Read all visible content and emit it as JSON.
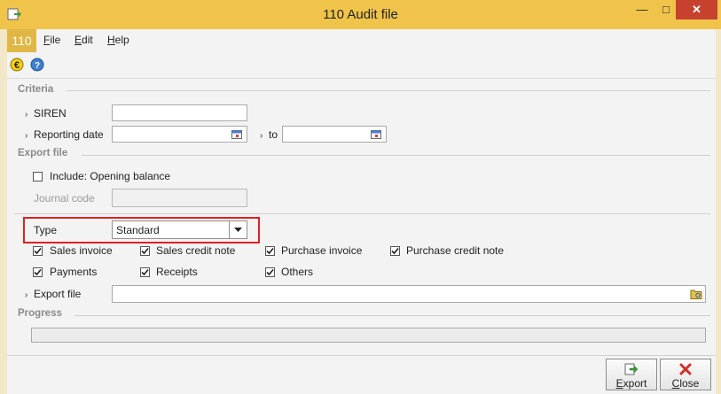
{
  "window": {
    "title": "110 Audit file"
  },
  "menubar": {
    "badge": "110",
    "items": [
      {
        "first": "F",
        "rest": "ile"
      },
      {
        "first": "E",
        "rest": "dit"
      },
      {
        "first": "H",
        "rest": "elp"
      }
    ]
  },
  "toolbar": {
    "icons": [
      "euro-icon",
      "help-icon"
    ]
  },
  "criteria": {
    "section_label": "Criteria",
    "siren_label": "SIREN",
    "siren_value": "",
    "reporting_date_label": "Reporting date",
    "reporting_date_from": "",
    "to_label": "to",
    "reporting_date_to": ""
  },
  "export": {
    "section_label": "Export file",
    "include_opening_balance_label": "Include: Opening balance",
    "include_opening_balance_checked": false,
    "journal_code_label": "Journal code",
    "journal_code_value": "",
    "type_label": "Type",
    "type_value": "Standard",
    "options": [
      {
        "label": "Sales invoice",
        "checked": true
      },
      {
        "label": "Sales credit note",
        "checked": true
      },
      {
        "label": "Purchase invoice",
        "checked": true
      },
      {
        "label": "Purchase credit note",
        "checked": true
      },
      {
        "label": "Payments",
        "checked": true
      },
      {
        "label": "Receipts",
        "checked": true
      },
      {
        "label": "Others",
        "checked": true
      }
    ],
    "export_file_label": "Export file",
    "export_file_value": ""
  },
  "progress": {
    "section_label": "Progress",
    "value": 0
  },
  "footer": {
    "export_first": "E",
    "export_rest": "xport",
    "close_first": "C",
    "close_rest": "lose"
  },
  "colors": {
    "title_bar": "#f0c44a",
    "close_button": "#c7412f",
    "highlight_border": "#e02020"
  }
}
